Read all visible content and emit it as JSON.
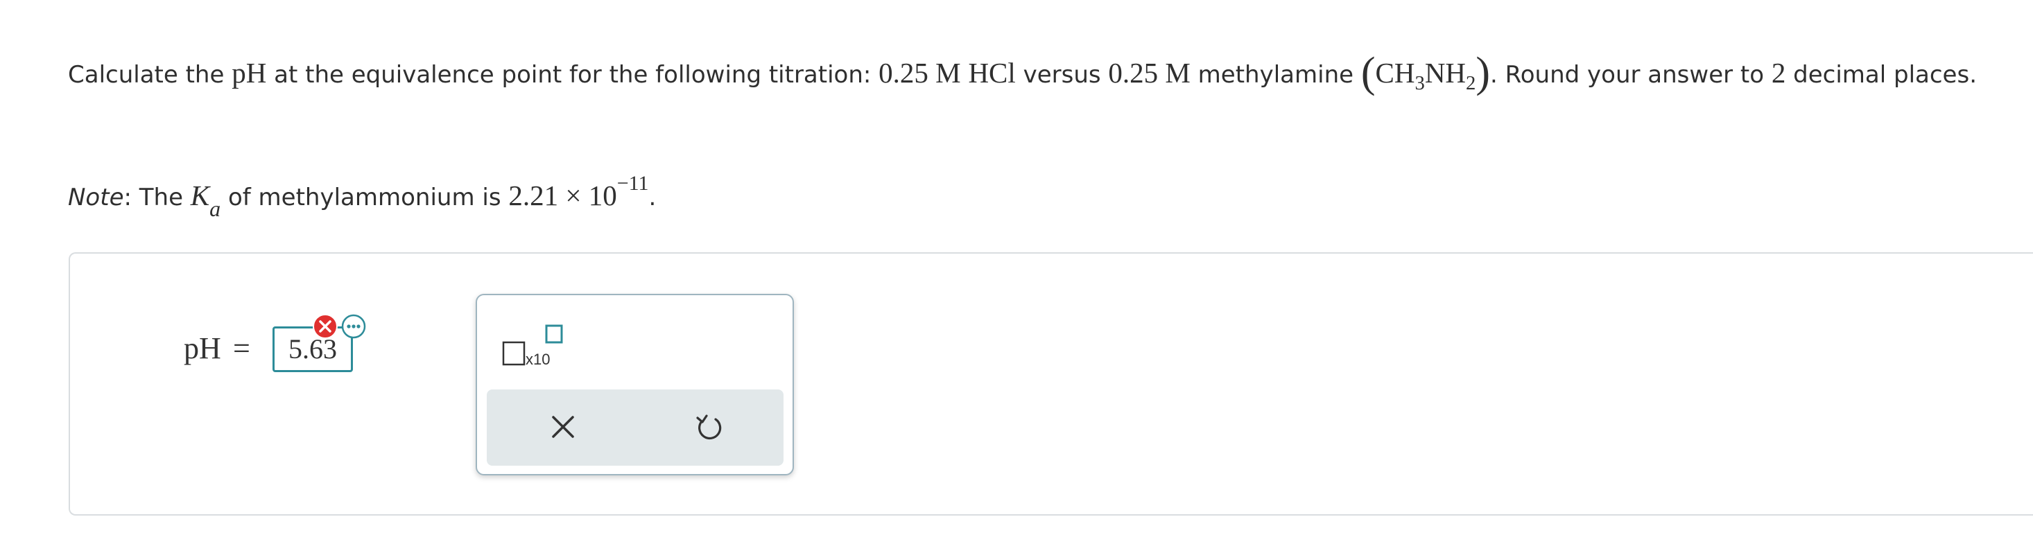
{
  "question": {
    "intro": "Calculate the ",
    "ph_symbol": "pH",
    "mid": " at the equivalence point for the following titration: ",
    "acid_conc": "0.25 M",
    "acid": "HCl",
    "versus": " versus ",
    "base_conc": "0.25 M",
    "base_name": " methylamine ",
    "formula": {
      "c": "CH",
      "c_sub": "3",
      "n": "NH",
      "n_sub": "2"
    },
    "round_text": ". Round your answer to ",
    "round_digits": "2",
    "round_tail": " decimal places."
  },
  "note": {
    "label": "Note",
    "text1": ": The ",
    "k_symbol": "K",
    "k_sub": "a",
    "text2": " of methylammonium is ",
    "mantissa": "2.21",
    "times": " × ",
    "base": "10",
    "exponent": "−11",
    "end": "."
  },
  "answer": {
    "label": "pH",
    "equals": "=",
    "value": "5.63"
  },
  "palette": {
    "sci_label": "x10"
  },
  "colors": {
    "accent": "#2d8c99",
    "error": "#e0302f",
    "action_bar": "#e2e8ea"
  }
}
